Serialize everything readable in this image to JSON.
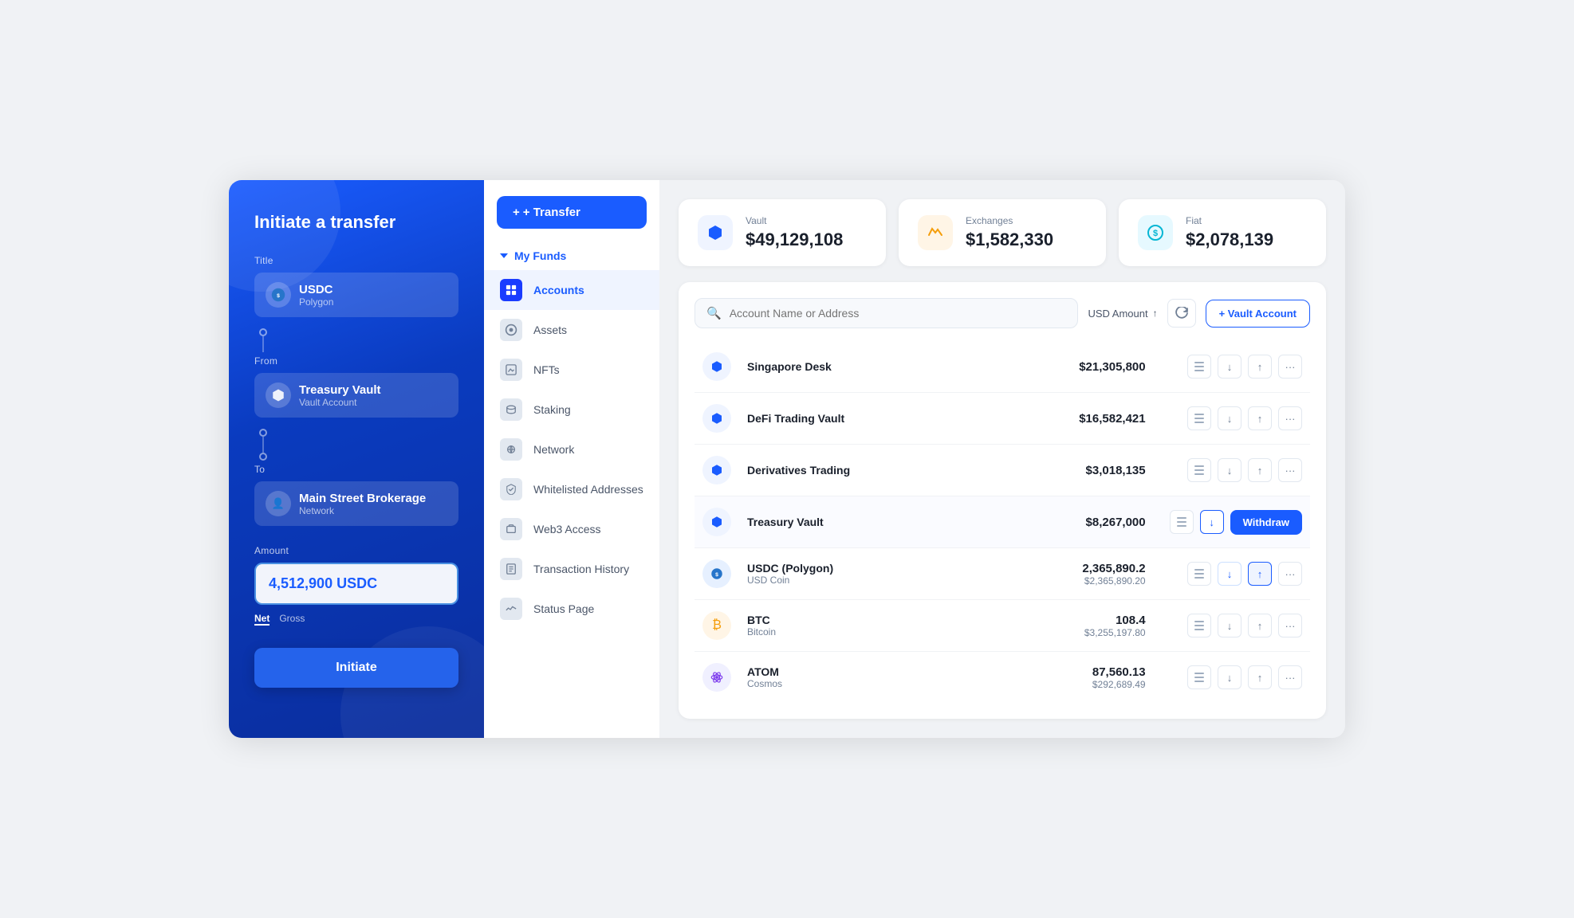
{
  "leftPanel": {
    "title": "Initiate a transfer",
    "formTitle": "Title",
    "assetName": "USDC",
    "assetNetwork": "Polygon",
    "fromLabel": "From",
    "fromName": "Treasury Vault",
    "fromSub": "Vault Account",
    "toLabel": "To",
    "toName": "Main Street Brokerage",
    "toSub": "Network",
    "amountLabel": "Amount",
    "amountValue": "4,512,900 USDC",
    "netLabel": "Net",
    "grossLabel": "Gross",
    "initiateBtn": "Initiate"
  },
  "nav": {
    "transferBtn": "+ Transfer",
    "myFunds": "My Funds",
    "items": [
      {
        "id": "accounts",
        "label": "Accounts",
        "active": true
      },
      {
        "id": "assets",
        "label": "Assets",
        "active": false
      },
      {
        "id": "nfts",
        "label": "NFTs",
        "active": false
      },
      {
        "id": "staking",
        "label": "Staking",
        "active": false
      },
      {
        "id": "network",
        "label": "Network",
        "active": false
      },
      {
        "id": "whitelisted",
        "label": "Whitelisted Addresses",
        "active": false
      },
      {
        "id": "web3",
        "label": "Web3 Access",
        "active": false
      },
      {
        "id": "history",
        "label": "Transaction History",
        "active": false
      },
      {
        "id": "status",
        "label": "Status Page",
        "active": false
      }
    ]
  },
  "stats": {
    "vault": {
      "label": "Vault",
      "value": "$49,129,108"
    },
    "exchanges": {
      "label": "Exchanges",
      "value": "$1,582,330"
    },
    "fiat": {
      "label": "Fiat",
      "value": "$2,078,139"
    }
  },
  "accounts": {
    "searchPlaceholder": "Account Name or Address",
    "sortLabel": "USD Amount",
    "vaultAccountBtn": "+ Vault Account",
    "rows": [
      {
        "id": 1,
        "name": "Singapore Desk",
        "sub": "",
        "amount": "$21,305,800",
        "amountSub": "",
        "type": "vault",
        "showWithdraw": false
      },
      {
        "id": 2,
        "name": "DeFi Trading Vault",
        "sub": "",
        "amount": "$16,582,421",
        "amountSub": "",
        "type": "vault",
        "showWithdraw": false
      },
      {
        "id": 3,
        "name": "Derivatives Trading",
        "sub": "",
        "amount": "$3,018,135",
        "amountSub": "",
        "type": "vault",
        "showWithdraw": false
      },
      {
        "id": 4,
        "name": "Treasury Vault",
        "sub": "",
        "amount": "$8,267,000",
        "amountSub": "",
        "type": "vault",
        "showWithdraw": true
      },
      {
        "id": 5,
        "name": "USDC (Polygon)",
        "sub": "USD Coin",
        "amount": "2,365,890.2",
        "amountSub": "$2,365,890.20",
        "type": "usdc",
        "showWithdraw": false
      },
      {
        "id": 6,
        "name": "BTC",
        "sub": "Bitcoin",
        "amount": "108.4",
        "amountSub": "$3,255,197.80",
        "type": "btc",
        "showWithdraw": false
      },
      {
        "id": 7,
        "name": "ATOM",
        "sub": "Cosmos",
        "amount": "87,560.13",
        "amountSub": "$292,689.49",
        "type": "atom",
        "showWithdraw": false
      }
    ]
  }
}
